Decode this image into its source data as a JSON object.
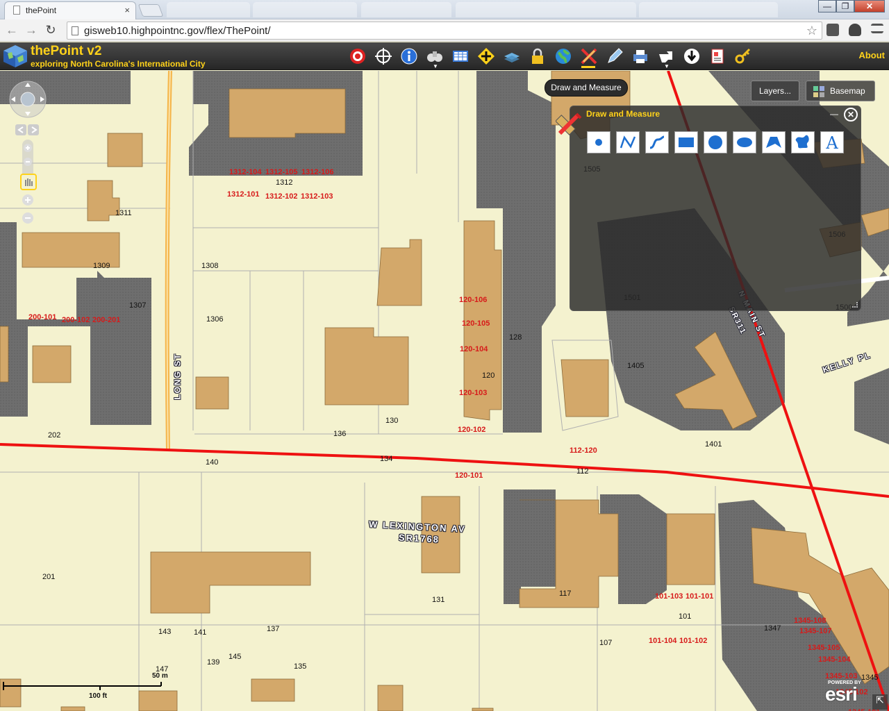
{
  "browser": {
    "tab_title": "thePoint",
    "tab_close": "×",
    "url": "gisweb10.highpointnc.gov/flex/ThePoint/",
    "back": "←",
    "forward": "→",
    "reload": "↻",
    "star": "☆",
    "win_min": "—",
    "win_max": "❐",
    "win_close": "✕"
  },
  "app": {
    "title": "thePoint v2",
    "subtitle": "exploring North Carolina's International City",
    "about": "About",
    "toolbar": [
      "target-icon",
      "crosshair-icon",
      "info-icon",
      "binoculars-icon",
      "table-icon",
      "move-icon",
      "layers-stack-icon",
      "lock-icon",
      "globe-icon",
      "draw-measure-icon",
      "pencil-icon",
      "print-icon",
      "hand-pointer-icon",
      "download-icon",
      "document-icon",
      "key-icon"
    ]
  },
  "map": {
    "tooltip": "Draw and Measure",
    "layers_button": "Layers...",
    "basemap_button": "Basemap",
    "draw_panel": {
      "title": "Draw and Measure",
      "minimize": "—",
      "close": "✕",
      "tools": [
        "point-tool-icon",
        "polyline-tool-icon",
        "freehand-line-tool-icon",
        "rectangle-tool-icon",
        "circle-tool-icon",
        "ellipse-tool-icon",
        "polygon-tool-icon",
        "freehand-polygon-tool-icon",
        "text-tool-icon"
      ]
    },
    "streets": [
      "LONG ST",
      "W LEXINGTON AV",
      "SR1768",
      "N MAIN ST",
      "SR311",
      "KELLY PL"
    ],
    "parcels": [
      "1312-104",
      "1312-105",
      "1312-106",
      "1312",
      "1312-101",
      "1312-102",
      "1312-103",
      "1311",
      "1309",
      "1308",
      "1307",
      "1306",
      "200-101",
      "200-102",
      "200-201",
      "202",
      "140",
      "136",
      "130",
      "134",
      "120-106",
      "120-105",
      "120-104",
      "120",
      "120-103",
      "120-102",
      "120-101",
      "128",
      "1505",
      "1506",
      "1501",
      "1500",
      "1405",
      "1401",
      "112-120",
      "112",
      "201",
      "131",
      "117",
      "107",
      "143",
      "141",
      "137",
      "145",
      "139",
      "147",
      "135",
      "101-103",
      "101-101",
      "101",
      "101-104",
      "101-102",
      "1347",
      "1345-108",
      "1345-107",
      "1345-105",
      "1345-104",
      "1345-103",
      "1345",
      "1345-102",
      "1345-101"
    ],
    "scale": {
      "metric": "50 m",
      "imperial": "100 ft"
    },
    "attribution_top": "POWERED BY",
    "attribution": "esri"
  }
}
